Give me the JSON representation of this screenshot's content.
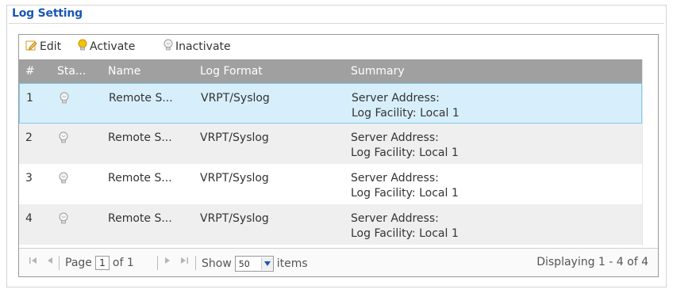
{
  "panel": {
    "title": "Log Setting"
  },
  "toolbar": {
    "edit_label": "Edit",
    "activate_label": "Activate",
    "inactivate_label": "Inactivate"
  },
  "columns": [
    "#",
    "Sta...",
    "Name",
    "Log Format",
    "Summary"
  ],
  "rows": [
    {
      "num": "1",
      "status": "inactive",
      "name": "Remote S...",
      "format": "VRPT/Syslog",
      "summary1": "Server Address:",
      "summary2": "Log Facility: Local 1",
      "selected": true
    },
    {
      "num": "2",
      "status": "inactive",
      "name": "Remote S...",
      "format": "VRPT/Syslog",
      "summary1": "Server Address:",
      "summary2": "Log Facility: Local 1",
      "selected": false
    },
    {
      "num": "3",
      "status": "inactive",
      "name": "Remote S...",
      "format": "VRPT/Syslog",
      "summary1": "Server Address:",
      "summary2": "Log Facility: Local 1",
      "selected": false
    },
    {
      "num": "4",
      "status": "inactive",
      "name": "Remote S...",
      "format": "VRPT/Syslog",
      "summary1": "Server Address:",
      "summary2": "Log Facility: Local 1",
      "selected": false
    }
  ],
  "pager": {
    "page_label": "Page",
    "page_value": "1",
    "of_label": "of 1",
    "show_label": "Show",
    "show_value": "50",
    "items_label": "items",
    "display_text": "Displaying 1 - 4 of 4"
  },
  "colors": {
    "title": "#1a57b5",
    "header_bg": "#a0a0a0",
    "selected_bg": "#d7effb",
    "alt_row_bg": "#efefef",
    "bulb_active": "#f2c200"
  },
  "icons": {
    "edit": "pencil-edit-icon",
    "activate": "lightbulb-on-icon",
    "inactivate": "lightbulb-off-icon",
    "status": "lightbulb-off-icon"
  }
}
